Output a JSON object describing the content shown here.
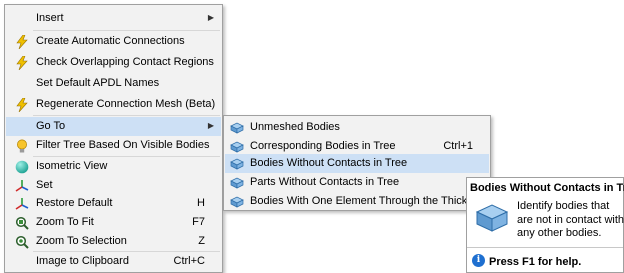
{
  "menu": {
    "items": [
      {
        "label": "Insert",
        "icon": "none",
        "submenu": true
      },
      {
        "label": "Create Automatic Connections",
        "icon": "lightning-icon"
      },
      {
        "label": "Check Overlapping Contact Regions",
        "icon": "lightning-icon"
      },
      {
        "label": "Set Default APDL Names",
        "icon": "none"
      },
      {
        "label": "Regenerate Connection Mesh (Beta)",
        "icon": "lightning-icon"
      },
      {
        "label": "Go To",
        "icon": "none",
        "submenu": true,
        "highlighted": true
      },
      {
        "label": "Filter Tree Based On Visible Bodies",
        "icon": "bulb-icon"
      },
      {
        "label": "Isometric View",
        "icon": "globe-icon"
      },
      {
        "label": "Set",
        "icon": "axes-icon"
      },
      {
        "label": "Restore Default",
        "icon": "axes-icon",
        "shortcut": "H"
      },
      {
        "label": "Zoom To Fit",
        "icon": "zoom-fit-icon",
        "shortcut": "F7"
      },
      {
        "label": "Zoom To Selection",
        "icon": "zoom-selection-icon",
        "shortcut": "Z"
      },
      {
        "label": "Image to Clipboard",
        "icon": "clipboard-icon",
        "shortcut": "Ctrl+C"
      }
    ]
  },
  "submenu": {
    "items": [
      {
        "label": "Unmeshed Bodies",
        "icon": "bodies-icon"
      },
      {
        "label": "Corresponding Bodies in Tree",
        "icon": "bodies-icon",
        "shortcut": "Ctrl+1"
      },
      {
        "label": "Bodies Without Contacts in Tree",
        "icon": "bodies-icon",
        "highlighted": true
      },
      {
        "label": "Parts Without Contacts in Tree",
        "icon": "bodies-icon"
      },
      {
        "label": "Bodies With One Element Through the Thickness",
        "icon": "bodies-icon"
      }
    ]
  },
  "tooltip": {
    "title": "Bodies Without Contacts in Tree",
    "body": "Identify bodies that are not in contact with any other bodies.",
    "help": "Press F1 for help."
  },
  "colors": {
    "highlight": "#cde0f5",
    "menu_bg": "#f2f2f2",
    "lightning": "#f0c000",
    "info": "#1e6fd0"
  }
}
